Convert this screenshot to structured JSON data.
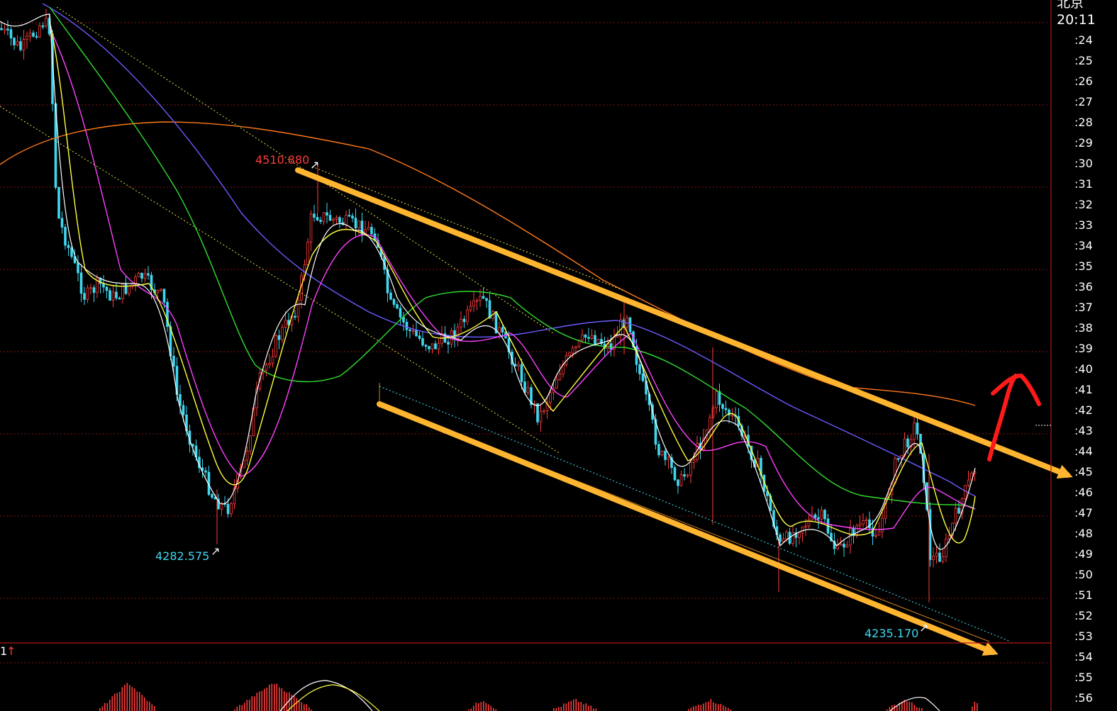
{
  "axis": {
    "header_top": "北京",
    "current_time": "20:11",
    "tick_labels": [
      ":24",
      ":25",
      ":26",
      ":27",
      ":28",
      ":29",
      ":30",
      ":31",
      ":32",
      ":33",
      ":34",
      ":35",
      ":36",
      ":37",
      ":38",
      ":39",
      ":40",
      ":41",
      ":42",
      ":43",
      ":44",
      ":45",
      ":46",
      ":47",
      ":48",
      ":49",
      ":50",
      ":51",
      ":52",
      ":53",
      ":54",
      ":55",
      ":56"
    ]
  },
  "annotations": {
    "high_price": "4510.880",
    "low_price_left": "4282.575",
    "low_price_right": "4235.170",
    "sub_indicator_label": "1",
    "sub_indicator_arrow": "↑"
  },
  "colors": {
    "background": "#000000",
    "grid": "#8a1414",
    "candle_up": "#ff3b3b",
    "candle_down": "#40d8f0",
    "ma_white": "#ffffff",
    "ma_yellow": "#ffff40",
    "ma_magenta": "#ff40ff",
    "ma_green": "#30e030",
    "ma_blue": "#6a5aff",
    "ma_orange": "#ff7a1a",
    "channel_arrow": "#ffb530",
    "hand_arrow": "#ff1a1a"
  },
  "chart_data": {
    "type": "candlestick",
    "price_ticks": [
      "4510.880",
      "4282.575",
      "4235.170"
    ],
    "series": [
      {
        "values": [
          4630,
          4560,
          4470,
          4440,
          4360,
          4300,
          4300,
          4460,
          4500,
          4490,
          4420,
          4390,
          4410,
          4420,
          4370,
          4360,
          4380,
          4360,
          4330,
          4335,
          4310,
          4300,
          4290,
          4320,
          4335,
          4330
        ]
      }
    ],
    "channel": {
      "upper": [
        4500,
        4310
      ],
      "lower": [
        4380,
        4180
      ]
    }
  }
}
